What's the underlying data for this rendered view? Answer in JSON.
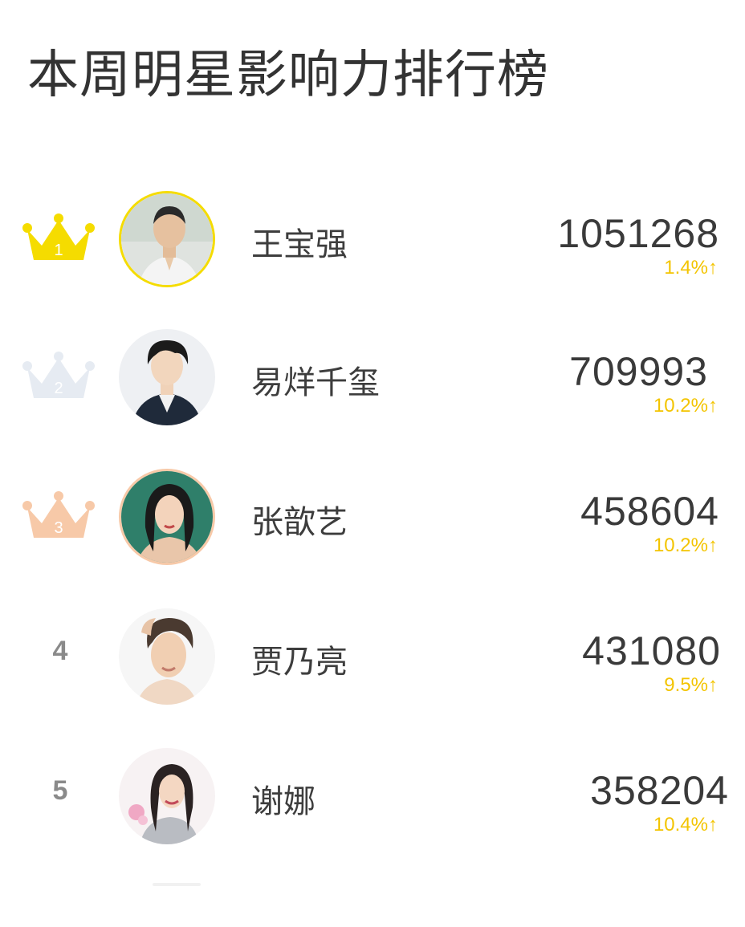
{
  "title": "本周明星影响力排行榜",
  "colors": {
    "gold": "#f5dc00",
    "silver": "#e6ebf2",
    "bronze": "#f7c9a8",
    "growth": "#f3c400"
  },
  "rankings": [
    {
      "rank": "1",
      "name": "王宝强",
      "score": "1051268",
      "growth": "1.4%↑",
      "badge": "gold-crown-icon"
    },
    {
      "rank": "2",
      "name": "易烊千玺",
      "score": "709993",
      "growth": "10.2%↑",
      "badge": "silver-crown-icon"
    },
    {
      "rank": "3",
      "name": "张歆艺",
      "score": "458604",
      "growth": "10.2%↑",
      "badge": "bronze-crown-icon"
    },
    {
      "rank": "4",
      "name": "贾乃亮",
      "score": "431080",
      "growth": "9.5%↑"
    },
    {
      "rank": "5",
      "name": "谢娜",
      "score": "358204",
      "growth": "10.4%↑"
    }
  ]
}
